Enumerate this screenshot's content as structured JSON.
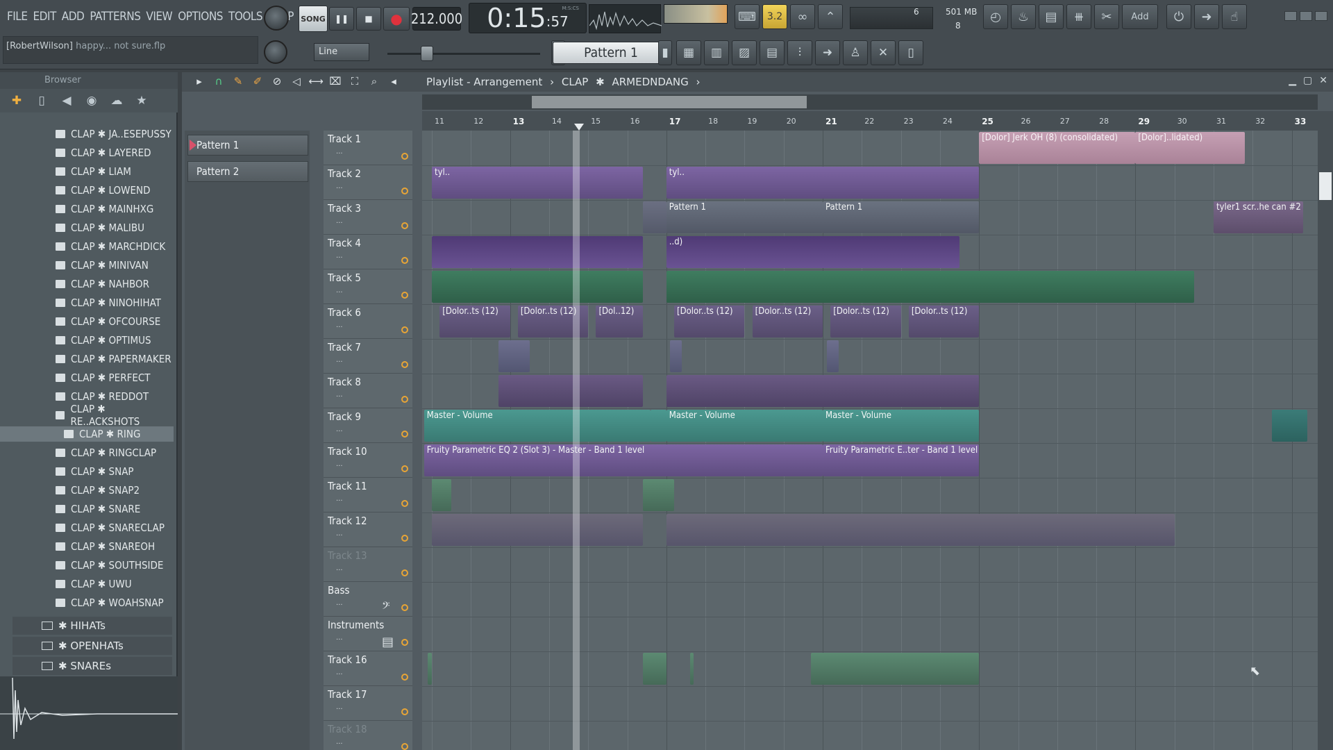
{
  "menu": [
    "FILE",
    "EDIT",
    "ADD",
    "PATTERNS",
    "VIEW",
    "OPTIONS",
    "TOOLS",
    "HELP"
  ],
  "hint": {
    "user": "[RobertWilson]",
    "text": "happy... not sure.flp"
  },
  "transport": {
    "mode": "SONG",
    "tempo": "212.000",
    "time_main": "0:15",
    "time_sub": ":57",
    "time_unit_label": "M:S:CS"
  },
  "cpu": {
    "polyphony": "6",
    "memory": "501 MB",
    "count": "8"
  },
  "toolbar2": {
    "snap": "Line",
    "pattern": "Pattern 1"
  },
  "browser": {
    "title": "Browser",
    "items": [
      "CLAP ✱ JA..ESEPUSSY",
      "CLAP ✱ LAYERED",
      "CLAP ✱ LIAM",
      "CLAP ✱ LOWEND",
      "CLAP ✱ MAINHXG",
      "CLAP ✱ MALIBU",
      "CLAP ✱ MARCHDICK",
      "CLAP ✱ MINIVAN",
      "CLAP ✱ NAHBOR",
      "CLAP ✱ NINOHIHAT",
      "CLAP ✱ OFCOURSE",
      "CLAP ✱ OPTIMUS",
      "CLAP ✱ PAPERMAKER",
      "CLAP ✱ PERFECT",
      "CLAP ✱ REDDOT",
      "CLAP ✱ RE..ACKSHOTS",
      "CLAP ✱ RING",
      "CLAP ✱ RINGCLAP",
      "CLAP ✱ SNAP",
      "CLAP ✱ SNAP2",
      "CLAP ✱ SNARE",
      "CLAP ✱ SNARECLAP",
      "CLAP ✱ SNAREOH",
      "CLAP ✱ SOUTHSIDE",
      "CLAP ✱ UWU",
      "CLAP ✱ WOAHSNAP"
    ],
    "selected_index": 16,
    "folders": [
      "✱ HIHATs",
      "✱ OPENHATs",
      "✱ SNAREs"
    ]
  },
  "playlist": {
    "title_parts": [
      "Playlist - Arrangement",
      "›",
      "CLAP",
      "✱",
      "ARMEDNDANG",
      "›"
    ],
    "patterns": [
      "Pattern 1",
      "Pattern 2"
    ],
    "tracks": [
      "Track 1",
      "Track 2",
      "Track 3",
      "Track 4",
      "Track 5",
      "Track 6",
      "Track 7",
      "Track 8",
      "Track 9",
      "Track 10",
      "Track 11",
      "Track 12",
      "Track 13",
      "Bass",
      "Instruments",
      "Track 16",
      "Track 17",
      "Track 18"
    ],
    "ruler": [
      "11",
      "12",
      "13",
      "14",
      "15",
      "16",
      "17",
      "18",
      "19",
      "20",
      "21",
      "22",
      "23",
      "24",
      "25",
      "26",
      "27",
      "28",
      "29",
      "30",
      "31",
      "32",
      "33"
    ],
    "clip_labels": {
      "t1a": "[Dolor] Jerk OH (8) (consolidated)",
      "t1b": "[Dolor]..lidated)",
      "t2": "tyl..",
      "t3a": "Pattern 1",
      "t3b": "Pattern 1",
      "t3c": "tyler1 scr..he can #2",
      "t4": "..d)",
      "t6a": "[Dolor..ts (12)",
      "t6b": "[Dolor..ts (12)",
      "t6c": "[Dol..12)",
      "t6d": "[Dolor..ts (12)",
      "t6e": "[Dolor..ts (12)",
      "t6f": "[Dolor..ts (12)",
      "t6g": "[Dolor..ts (12)",
      "t9a": "Master - Volume",
      "t9b": "Master - Volume",
      "t9c": "Master - Volume",
      "t10a": "Fruity Parametric EQ 2 (Slot 3) - Master - Band 1 level",
      "t10b": "Fruity Parametric E..ter - Band 1 level"
    }
  },
  "colors": {
    "accent": "#e8a536",
    "clip_purple": "#8a6fb0",
    "clip_green": "#3d7a5e",
    "clip_teal": "#3f8e86",
    "clip_pink": "#c99fb6"
  }
}
